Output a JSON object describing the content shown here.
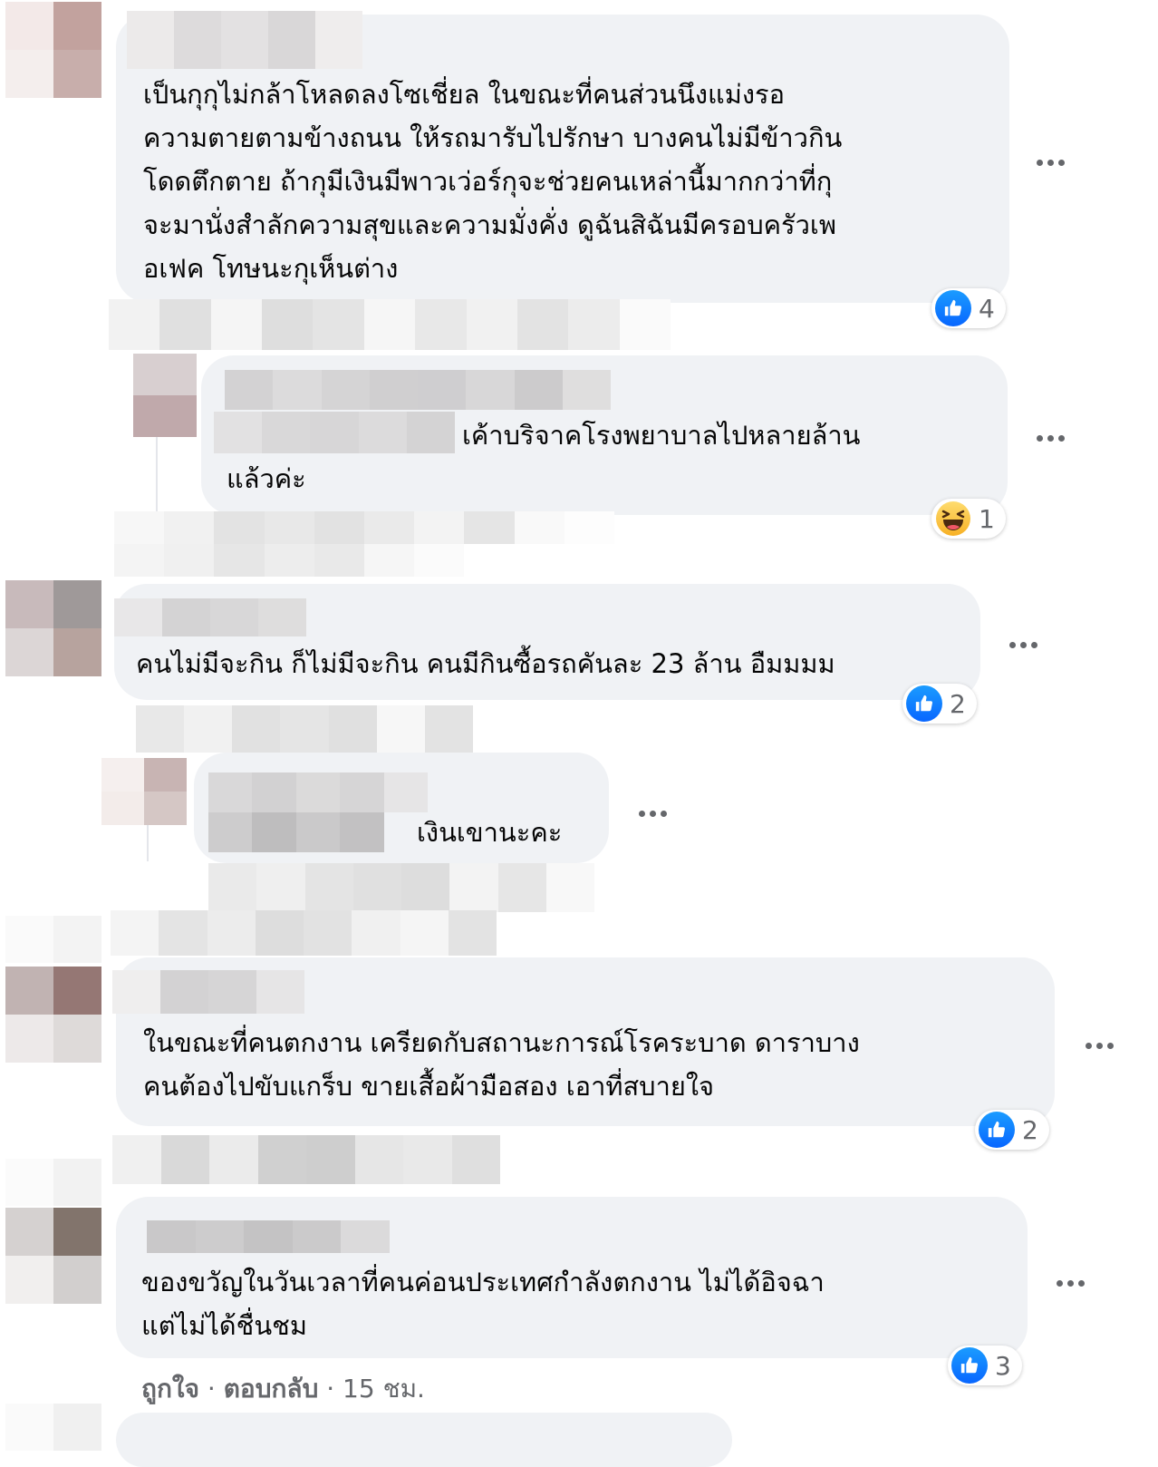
{
  "comments": [
    {
      "text": "เป็นกุกุไม่กล้าโหลดลงโซเชี่ยล ในขณะที่คนส่วนนึงแม่งรอ\nความตายตามข้างถนน ให้รถมารับไปรักษา บางคนไม่มีข้าวกิน\nโดดตึกตาย ถ้ากุมีเงินมีพาวเว่อร์กุจะช่วยคนเหล่านี้มากกว่าที่กุ\nจะมานั่งสำลักความสุขและความมั่งคั่ง ดูฉันสิฉันมีครอบครัวเพ\nอเฟค โทษนะกุเห็นต่าง",
      "reaction": "like",
      "reaction_count": "4"
    },
    {
      "text": "เค้าบริจาคโรงพยาบาลไปหลายล้าน",
      "text2": "แล้วค่ะ",
      "reaction": "haha",
      "reaction_count": "1"
    },
    {
      "text": "คนไม่มีจะกิน ก็ไม่มีจะกิน คนมีกินซื้อรถคันละ 23 ล้าน อืมมมม",
      "reaction": "like",
      "reaction_count": "2"
    },
    {
      "text": "เงินเขานะคะ"
    },
    {
      "text": "ในขณะที่คนตกงาน เครียดกับสถานะการณ์โรคระบาด ดาราบาง\nคนต้องไปขับแกร็บ ขายเสื้อผ้ามือสอง เอาที่สบายใจ",
      "reaction": "like",
      "reaction_count": "2"
    },
    {
      "text": "ของขวัญในวันเวลาที่คนค่อนประเทศกำลังตกงาน ไม่ได้อิจฉา\nแต่ไม่ได้ชื่นชม",
      "reaction": "like",
      "reaction_count": "3",
      "actions": {
        "like": "ถูกใจ",
        "sep": " · ",
        "reply": "ตอบกลับ",
        "time": " · 15 ชม."
      }
    }
  ],
  "icons": {
    "more": "more-horizontal-icon",
    "like": "like-reaction-icon",
    "haha": "haha-reaction-icon"
  },
  "colors": {
    "bubble": "#f0f2f5",
    "like_blue": "#0866ff",
    "meta_gray": "#65676b"
  }
}
